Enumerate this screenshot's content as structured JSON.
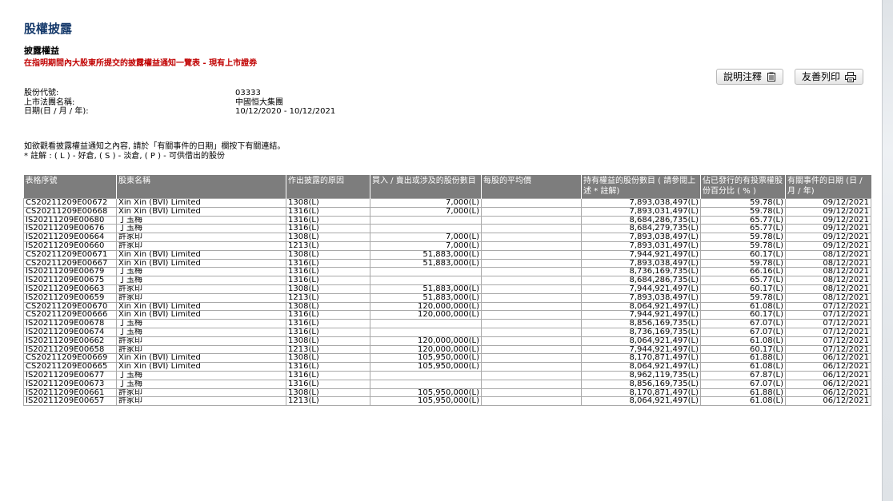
{
  "header": {
    "page_title": "股權披露",
    "section_title": "披露權益",
    "section_subtitle": "在指明期間內大股東所提交的披露權益通知一覽表 - 現有上市證券"
  },
  "toolbar": {
    "notes_label": "說明注釋",
    "print_label": "友善列印"
  },
  "info": {
    "stock_code_label": "股份代號:",
    "stock_code": "03333",
    "company_label": "上市法團名稱:",
    "company": "中國恒大集團",
    "date_label": "日期(日 / 月 / 年):",
    "date_range": "10/12/2020 - 10/12/2021"
  },
  "notes": {
    "line1": "如欲觀看披露權益通知之內容, 請於「有關事件的日期」欄按下有關連結。",
    "line2": "* 註解 : ( L ) - 好倉, ( S ) - 淡倉, ( P ) - 可供借出的股份"
  },
  "table": {
    "headers": [
      "表格序號",
      "股東名稱",
      "作出披露的原因",
      "買入 / 賣出或涉及的股份數目",
      "每股的平均價",
      "持有權益的股份數目 ( 請參閱上述 * 註解)",
      "佔已發行的有投票權股份百分比 ( % )",
      "有關事件的日期 (日 / 月 / 年)"
    ],
    "rows": [
      [
        "CS20211209E00672",
        "Xin Xin (BVI) Limited",
        "1308(L)",
        "7,000(L)",
        "",
        "7,893,038,497(L)",
        "59.78(L)",
        "09/12/2021"
      ],
      [
        "CS20211209E00668",
        "Xin Xin (BVI) Limited",
        "1316(L)",
        "7,000(L)",
        "",
        "7,893,031,497(L)",
        "59.78(L)",
        "09/12/2021"
      ],
      [
        "IS20211209E00680",
        "丁玉梅",
        "1316(L)",
        "",
        "",
        "8,684,286,735(L)",
        "65.77(L)",
        "09/12/2021"
      ],
      [
        "IS20211209E00676",
        "丁玉梅",
        "1316(L)",
        "",
        "",
        "8,684,279,735(L)",
        "65.77(L)",
        "09/12/2021"
      ],
      [
        "IS20211209E00664",
        "許家印",
        "1308(L)",
        "7,000(L)",
        "",
        "7,893,038,497(L)",
        "59.78(L)",
        "09/12/2021"
      ],
      [
        "IS20211209E00660",
        "許家印",
        "1213(L)",
        "7,000(L)",
        "",
        "7,893,031,497(L)",
        "59.78(L)",
        "09/12/2021"
      ],
      [
        "CS20211209E00671",
        "Xin Xin (BVI) Limited",
        "1308(L)",
        "51,883,000(L)",
        "",
        "7,944,921,497(L)",
        "60.17(L)",
        "08/12/2021"
      ],
      [
        "CS20211209E00667",
        "Xin Xin (BVI) Limited",
        "1316(L)",
        "51,883,000(L)",
        "",
        "7,893,038,497(L)",
        "59.78(L)",
        "08/12/2021"
      ],
      [
        "IS20211209E00679",
        "丁玉梅",
        "1316(L)",
        "",
        "",
        "8,736,169,735(L)",
        "66.16(L)",
        "08/12/2021"
      ],
      [
        "IS20211209E00675",
        "丁玉梅",
        "1316(L)",
        "",
        "",
        "8,684,286,735(L)",
        "65.77(L)",
        "08/12/2021"
      ],
      [
        "IS20211209E00663",
        "許家印",
        "1308(L)",
        "51,883,000(L)",
        "",
        "7,944,921,497(L)",
        "60.17(L)",
        "08/12/2021"
      ],
      [
        "IS20211209E00659",
        "許家印",
        "1213(L)",
        "51,883,000(L)",
        "",
        "7,893,038,497(L)",
        "59.78(L)",
        "08/12/2021"
      ],
      [
        "CS20211209E00670",
        "Xin Xin (BVI) Limited",
        "1308(L)",
        "120,000,000(L)",
        "",
        "8,064,921,497(L)",
        "61.08(L)",
        "07/12/2021"
      ],
      [
        "CS20211209E00666",
        "Xin Xin (BVI) Limited",
        "1316(L)",
        "120,000,000(L)",
        "",
        "7,944,921,497(L)",
        "60.17(L)",
        "07/12/2021"
      ],
      [
        "IS20211209E00678",
        "丁玉梅",
        "1316(L)",
        "",
        "",
        "8,856,169,735(L)",
        "67.07(L)",
        "07/12/2021"
      ],
      [
        "IS20211209E00674",
        "丁玉梅",
        "1316(L)",
        "",
        "",
        "8,736,169,735(L)",
        "67.07(L)",
        "07/12/2021"
      ],
      [
        "IS20211209E00662",
        "許家印",
        "1308(L)",
        "120,000,000(L)",
        "",
        "8,064,921,497(L)",
        "61.08(L)",
        "07/12/2021"
      ],
      [
        "IS20211209E00658",
        "許家印",
        "1213(L)",
        "120,000,000(L)",
        "",
        "7,944,921,497(L)",
        "60.17(L)",
        "07/12/2021"
      ],
      [
        "CS20211209E00669",
        "Xin Xin (BVI) Limited",
        "1308(L)",
        "105,950,000(L)",
        "",
        "8,170,871,497(L)",
        "61.88(L)",
        "06/12/2021"
      ],
      [
        "CS20211209E00665",
        "Xin Xin (BVI) Limited",
        "1316(L)",
        "105,950,000(L)",
        "",
        "8,064,921,497(L)",
        "61.08(L)",
        "06/12/2021"
      ],
      [
        "IS20211209E00677",
        "丁玉梅",
        "1316(L)",
        "",
        "",
        "8,962,119,735(L)",
        "67.87(L)",
        "06/12/2021"
      ],
      [
        "IS20211209E00673",
        "丁玉梅",
        "1316(L)",
        "",
        "",
        "8,856,169,735(L)",
        "67.07(L)",
        "06/12/2021"
      ],
      [
        "IS20211209E00661",
        "許家印",
        "1308(L)",
        "105,950,000(L)",
        "",
        "8,170,871,497(L)",
        "61.88(L)",
        "06/12/2021"
      ],
      [
        "IS20211209E00657",
        "許家印",
        "1213(L)",
        "105,950,000(L)",
        "",
        "8,064,921,497(L)",
        "61.08(L)",
        "06/12/2021"
      ]
    ]
  },
  "colors": {
    "title": "#163a6b",
    "subtitle_red": "#c00000",
    "header_bg": "#7d7d7d",
    "link": "#1a3f8a"
  },
  "icons": {
    "notes": "notes-icon",
    "print": "printer-icon"
  }
}
